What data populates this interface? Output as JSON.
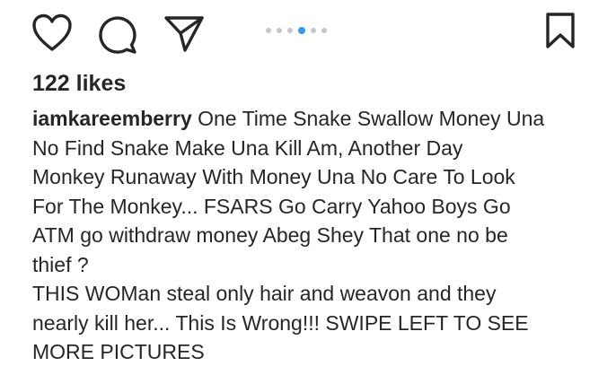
{
  "actions": {
    "like_icon": "heart-icon",
    "comment_icon": "comment-icon",
    "share_icon": "paper-plane-icon",
    "save_icon": "bookmark-icon"
  },
  "carousel": {
    "total": 6,
    "active_index": 3,
    "active_color": "#3897f0",
    "inactive_color": "#c7c7c7"
  },
  "post": {
    "likes_text": "122 likes",
    "username": "iamkareemberry",
    "caption_lines": [
      "One Time Snake Swallow Money Una",
      "No Find Snake Make Una Kill Am, Another Day",
      "Monkey Runaway With Money Una No Care To Look",
      "For The Monkey... FSARS Go Carry Yahoo Boys Go",
      "ATM go withdraw money Abeg Shey That one no be",
      "thief ?",
      "THIS WOMan steal only hair and weavon and they",
      "nearly kill her... This Is Wrong!!! SWIPE LEFT TO SEE",
      "MORE PICTURES"
    ]
  }
}
